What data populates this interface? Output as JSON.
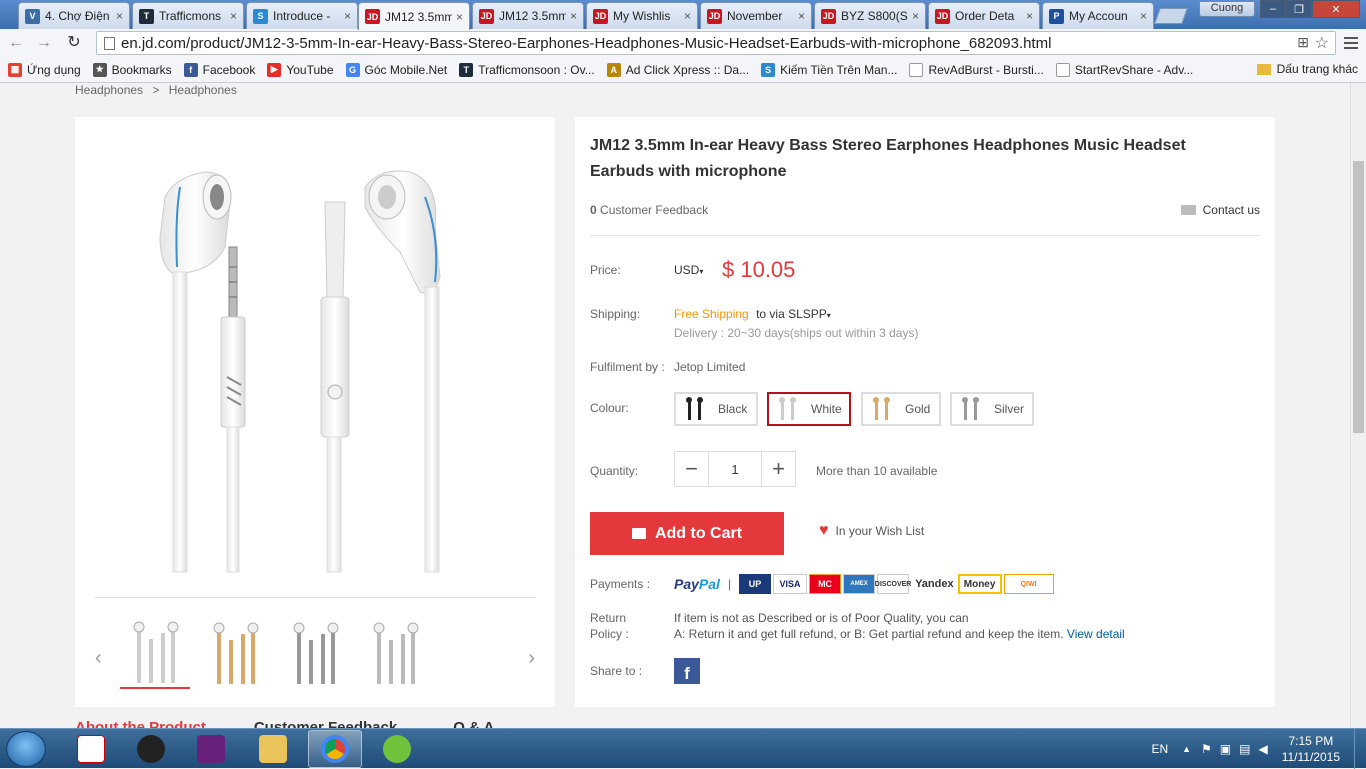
{
  "browser": {
    "tabs": [
      {
        "title": "4. Chợ Điện",
        "fav_color": "#3a6ea5",
        "fav_text": "V"
      },
      {
        "title": "Trafficmons",
        "fav_color": "#1d2b3a",
        "fav_text": "T"
      },
      {
        "title": "Introduce -",
        "fav_color": "#2a8ad4",
        "fav_text": "S"
      },
      {
        "title": "JM12 3.5mm",
        "fav_color": "#c81623",
        "fav_text": "JD"
      },
      {
        "title": "JM12 3.5mm",
        "fav_color": "#c81623",
        "fav_text": "JD"
      },
      {
        "title": "My Wishlis",
        "fav_color": "#c81623",
        "fav_text": "JD"
      },
      {
        "title": "November",
        "fav_color": "#c81623",
        "fav_text": "JD"
      },
      {
        "title": "BYZ S800(S",
        "fav_color": "#c81623",
        "fav_text": "JD"
      },
      {
        "title": "Order Deta",
        "fav_color": "#c81623",
        "fav_text": "JD"
      },
      {
        "title": "My Accoun",
        "fav_color": "#1d4f9c",
        "fav_text": "P"
      }
    ],
    "active_tab": 3,
    "user": "Cuong",
    "url": "en.jd.com/product/JM12-3-5mm-In-ear-Heavy-Bass-Stereo-Earphones-Headphones-Music-Headset-Earbuds-with-microphone_682093.html",
    "bookmarks": [
      {
        "label": "Ứng dụng",
        "color": "#e34133",
        "text": "▦"
      },
      {
        "label": "Bookmarks",
        "color": "#555555",
        "text": "★"
      },
      {
        "label": "Facebook",
        "color": "#3b5998",
        "text": "f"
      },
      {
        "label": "YouTube",
        "color": "#e52d27",
        "text": "▶"
      },
      {
        "label": "Góc Mobile.Net",
        "color": "#4285f4",
        "text": "G"
      },
      {
        "label": "Trafficmonsoon : Ov...",
        "color": "#1d2b3a",
        "text": "T"
      },
      {
        "label": "Ad Click Xpress :: Da...",
        "color": "#b8860b",
        "text": "A"
      },
      {
        "label": "Kiếm Tiền Trên Man...",
        "color": "#2a8ad4",
        "text": "S"
      },
      {
        "label": "RevAdBurst - Bursti...",
        "color": "#999999",
        "text": ""
      },
      {
        "label": "StartRevShare - Adv...",
        "color": "#999999",
        "text": ""
      }
    ],
    "other_bookmarks": "Dấu trang khác"
  },
  "page": {
    "breadcrumb": [
      "Headphones",
      ">",
      "Headphones"
    ],
    "product_title": "JM12 3.5mm In-ear Heavy Bass Stereo Earphones Headphones Music Headset Earbuds with microphone",
    "feedback_count": "0",
    "feedback_label": "Customer Feedback",
    "contact": "Contact us",
    "price_label": "Price:",
    "currency": "USD",
    "price": "$ 10.05",
    "shipping_label": "Shipping:",
    "free_shipping": "Free Shipping",
    "ship_via": "to via SLSPP",
    "delivery": "Delivery : 20~30 days(ships out within 3 days)",
    "fulfilment_label": "Fulfilment by :",
    "fulfilment": "Jetop Limited",
    "colour_label": "Colour:",
    "colours": [
      {
        "name": "Black",
        "swatch": "#222222"
      },
      {
        "name": "White",
        "swatch": "#cccccc"
      },
      {
        "name": "Gold",
        "swatch": "#d8a96a"
      },
      {
        "name": "Silver",
        "swatch": "#999999"
      }
    ],
    "selected_colour": "White",
    "quantity_label": "Quantity:",
    "quantity": "1",
    "availability": "More than 10 available",
    "add_to_cart": "Add to Cart",
    "wish_list": "In your Wish List",
    "payments_label": "Payments :",
    "payment_methods": [
      "PayPal",
      "UnionPay",
      "VISA",
      "MasterCard",
      "AMERICAN EXPRESS",
      "DISCOVER",
      "Yandex",
      "Money",
      "QIWI WALLET"
    ],
    "return_label_1": "Return",
    "return_label_2": "Policy :",
    "return_text_1": "If item is not as Described or is of Poor Quality, you can",
    "return_text_2": "A: Return it and get full refund, or B: Get partial refund and keep the item.",
    "view_detail": "View detail",
    "share_label": "Share to :",
    "bottom_tabs": [
      "About the Product",
      "Customer Feedback",
      "Q & A"
    ]
  },
  "taskbar": {
    "language": "EN",
    "time": "7:15 PM",
    "date": "11/11/2015"
  }
}
